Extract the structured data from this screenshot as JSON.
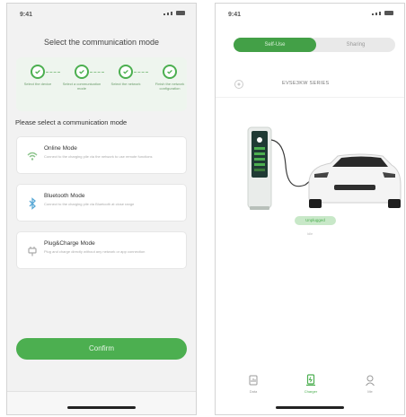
{
  "left_screen": {
    "status_time": "9:41",
    "title": "Select the communication mode",
    "steps": [
      {
        "label": "Select the device"
      },
      {
        "label": "Select a communication mode"
      },
      {
        "label": "Select the network"
      },
      {
        "label": "Finish the network configuration"
      }
    ],
    "section_label": "Please select a communication mode",
    "modes": [
      {
        "title": "Online Mode",
        "description": "Connect to the charging pile via the network to use remote functions",
        "icon": "wifi-icon"
      },
      {
        "title": "Bluetooth Mode",
        "description": "Connect to the charging pile via Bluetooth at close range",
        "icon": "bluetooth-icon"
      },
      {
        "title": "Plug&Charge Mode",
        "description": "Plug and charge directly without any network or app connection",
        "icon": "plug-icon"
      }
    ],
    "confirm_label": "Confirm",
    "accent": "#4caf50"
  },
  "right_screen": {
    "status_time": "9:41",
    "tabs": [
      "Self-Use",
      "Sharing"
    ],
    "active_tab": 0,
    "charger_name": "EVSE3KW SERIES",
    "status_pill": "Unplugged",
    "status_sub": "Idle",
    "nav": [
      {
        "label": "Data",
        "icon": "data-icon"
      },
      {
        "label": "Charger",
        "icon": "charger-icon"
      },
      {
        "label": "Me",
        "icon": "me-icon"
      }
    ],
    "active_nav": 1,
    "accent": "#43a047"
  }
}
